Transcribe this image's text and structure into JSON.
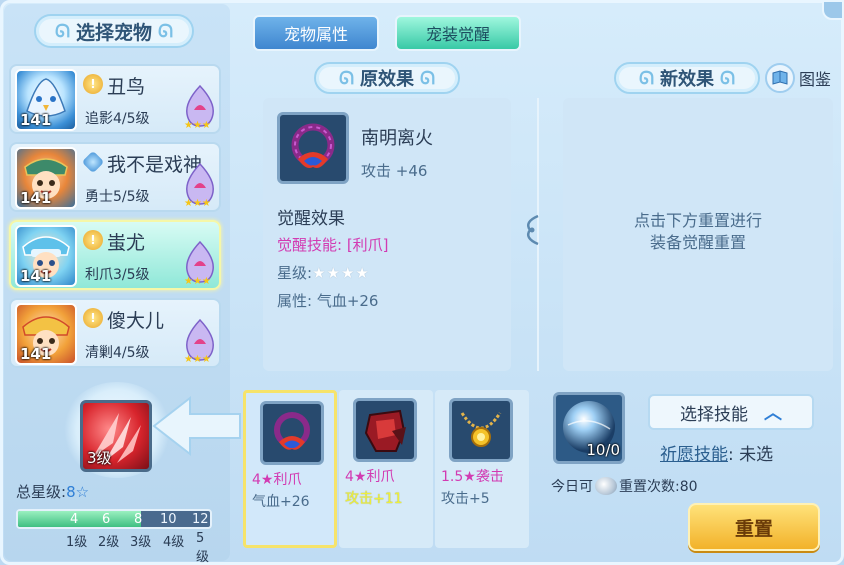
{
  "left": {
    "title": "选择宠物",
    "pets": [
      {
        "level": "141",
        "name": "丑鸟",
        "skill": "追影4/5级",
        "badge": "gold"
      },
      {
        "level": "141",
        "name": "我不是戏神",
        "skill": "勇士5/5级",
        "badge": "blue"
      },
      {
        "level": "141",
        "name": "蚩尤",
        "skill": "利爪3/5级",
        "badge": "gold",
        "selected": true
      },
      {
        "level": "141",
        "name": "傻大儿",
        "skill": "清剿4/5级",
        "badge": "gold"
      }
    ],
    "skill_level": "3级",
    "total_stars_label": "总星级:",
    "total_stars_value": "8☆",
    "progress": {
      "fill_fraction": 0.64,
      "ticks": [
        "4",
        "6",
        "8",
        "10",
        "12"
      ],
      "labels": [
        "1级",
        "2级",
        "3级",
        "4级",
        "5级"
      ]
    }
  },
  "tabs": [
    {
      "label": "宠物属性",
      "active": false
    },
    {
      "label": "宠装觉醒",
      "active": true
    }
  ],
  "original": {
    "title": "原效果",
    "equip_name": "南明离火",
    "equip_attr": "攻击 +46",
    "awaken_title": "觉醒效果",
    "awaken_skill": "觉醒技能: [利爪]",
    "stars_label": "星级:",
    "stars": "★★★★",
    "attr": "属性: 气血+26"
  },
  "new_effect": {
    "title": "新效果",
    "atlas_label": "图鉴",
    "hint_line1": "点击下方重置进行",
    "hint_line2": "装备觉醒重置"
  },
  "options": [
    {
      "line1": "4★利爪",
      "line2": "气血+26",
      "selected": true,
      "line2_color": "#4a6c8c"
    },
    {
      "line1": "4★利爪",
      "line2": "攻击+11",
      "selected": false,
      "line2_color": "#eef03c"
    },
    {
      "line1": "1.5★袭击",
      "line2": "攻击+5",
      "selected": false,
      "line2_color": "#4a6c8c"
    }
  ],
  "reset_panel": {
    "orb_count": "10/0",
    "choose_skill": "选择技能",
    "wish_label": "祈愿技能",
    "wish_value": "未选",
    "today_prefix": "今日可",
    "today_suffix": "重置次数:80",
    "reset_label": "重置"
  }
}
